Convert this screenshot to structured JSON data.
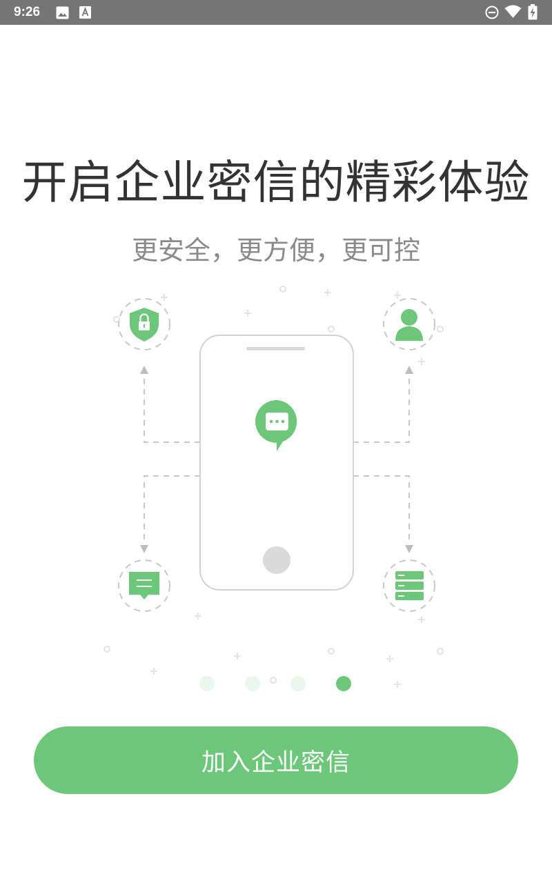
{
  "status_bar": {
    "time": "9:26",
    "left_icons": [
      "image-icon",
      "font-a-icon"
    ],
    "right_icons": [
      "do-not-disturb-icon",
      "wifi-icon",
      "battery-charging-icon"
    ],
    "background": "#757575"
  },
  "headline": "开启企业密信的精彩体验",
  "subline": "更安全，更方便，更可控",
  "illustration": {
    "center_icon": "chat-bubble-icon",
    "feature_icons": [
      "shield-lock-icon",
      "user-icon",
      "message-icon",
      "server-icon"
    ],
    "accent": "#6cc77b"
  },
  "pagination": {
    "count": 4,
    "active_index": 3
  },
  "join_button": {
    "label": "加入企业密信",
    "color": "#6cc77b"
  }
}
